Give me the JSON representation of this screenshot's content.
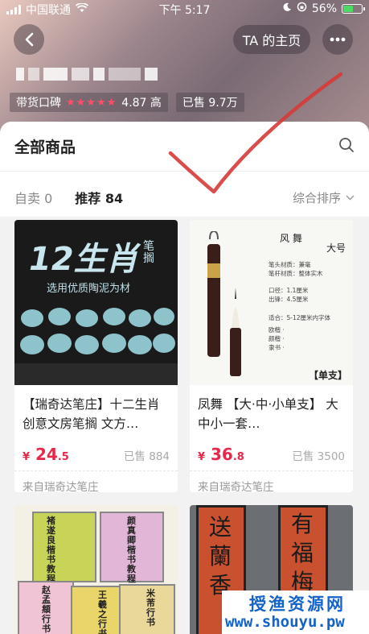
{
  "status_bar": {
    "carrier": "中国联通",
    "time": "下午 5:17",
    "battery": "56%",
    "battery_level": 0.56
  },
  "header": {
    "back_icon": "chevron-left-icon",
    "home_button_label": "TA 的主页",
    "more_icon": "more-icon",
    "shop_name_blurred": true
  },
  "stats": {
    "rating_label": "带货口碑",
    "rating_stars": "★★★★★",
    "rating_value": "4.87 高",
    "sales_label": "已售 9.7万"
  },
  "panel": {
    "title": "全部商品",
    "search_icon": "search-icon"
  },
  "tabs": {
    "self": "自卖 0",
    "recommended": "推荐 84",
    "sort": "综合排序",
    "active": "recommended"
  },
  "products": [
    {
      "title": "【瑞奇达笔庄】十二生肖创意文房笔搁 文方…",
      "price_int": "24",
      "price_dec": ".5",
      "currency": "¥",
      "sold": "已售 884",
      "from": "来自瑞奇达笔庄",
      "image_text": {
        "main": "12生肖",
        "side": "笔搁",
        "sub": "选用优质陶泥为材"
      }
    },
    {
      "title": "凤舞 【大·中·小单支】 大中小一套…",
      "price_int": "36",
      "price_dec": ".8",
      "currency": "¥",
      "sold": "已售 3500",
      "from": "来自瑞奇达笔庄",
      "image_text": {
        "head": "风  舞",
        "head2": "大号",
        "line1": "笔头材质：兼毫",
        "line2": "笔杆材质：整体实木",
        "line3": "口径：1.1厘米",
        "line4": "出锋：4.5厘米",
        "line5": "适合：5-12厘米内字体",
        "line6": "欧楷 ·",
        "line7": "颜楷 ·",
        "line8": "隶书 ·",
        "tag": "【单支】"
      }
    },
    {
      "title": "",
      "image_text": {
        "b1": "褚遂良楷书教程",
        "b2": "颜真卿楷书教程",
        "b3": "赵孟頫行书",
        "b4": "王羲之行书",
        "b5": "米芾行书"
      }
    },
    {
      "title": "",
      "image_text": {
        "c1": "送蘭香",
        "c2": "有福梅影"
      }
    }
  ],
  "watermark": {
    "line1": "授渔资源网",
    "line2": "www.shouyu.pw"
  }
}
